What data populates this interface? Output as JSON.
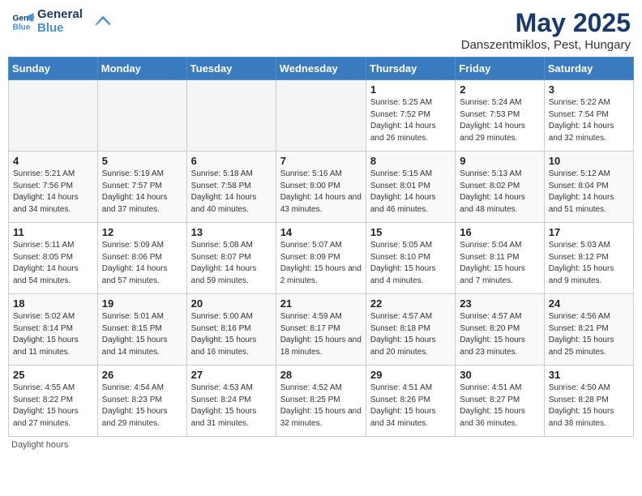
{
  "header": {
    "logo_line1": "General",
    "logo_line2": "Blue",
    "month_title": "May 2025",
    "location": "Danszentmiklos, Pest, Hungary"
  },
  "days_of_week": [
    "Sunday",
    "Monday",
    "Tuesday",
    "Wednesday",
    "Thursday",
    "Friday",
    "Saturday"
  ],
  "weeks": [
    [
      {
        "day": "",
        "empty": true
      },
      {
        "day": "",
        "empty": true
      },
      {
        "day": "",
        "empty": true
      },
      {
        "day": "",
        "empty": true
      },
      {
        "day": "1",
        "sunrise": "5:25 AM",
        "sunset": "7:52 PM",
        "daylight": "14 hours and 26 minutes."
      },
      {
        "day": "2",
        "sunrise": "5:24 AM",
        "sunset": "7:53 PM",
        "daylight": "14 hours and 29 minutes."
      },
      {
        "day": "3",
        "sunrise": "5:22 AM",
        "sunset": "7:54 PM",
        "daylight": "14 hours and 32 minutes."
      }
    ],
    [
      {
        "day": "4",
        "sunrise": "5:21 AM",
        "sunset": "7:56 PM",
        "daylight": "14 hours and 34 minutes."
      },
      {
        "day": "5",
        "sunrise": "5:19 AM",
        "sunset": "7:57 PM",
        "daylight": "14 hours and 37 minutes."
      },
      {
        "day": "6",
        "sunrise": "5:18 AM",
        "sunset": "7:58 PM",
        "daylight": "14 hours and 40 minutes."
      },
      {
        "day": "7",
        "sunrise": "5:16 AM",
        "sunset": "8:00 PM",
        "daylight": "14 hours and 43 minutes."
      },
      {
        "day": "8",
        "sunrise": "5:15 AM",
        "sunset": "8:01 PM",
        "daylight": "14 hours and 46 minutes."
      },
      {
        "day": "9",
        "sunrise": "5:13 AM",
        "sunset": "8:02 PM",
        "daylight": "14 hours and 48 minutes."
      },
      {
        "day": "10",
        "sunrise": "5:12 AM",
        "sunset": "8:04 PM",
        "daylight": "14 hours and 51 minutes."
      }
    ],
    [
      {
        "day": "11",
        "sunrise": "5:11 AM",
        "sunset": "8:05 PM",
        "daylight": "14 hours and 54 minutes."
      },
      {
        "day": "12",
        "sunrise": "5:09 AM",
        "sunset": "8:06 PM",
        "daylight": "14 hours and 57 minutes."
      },
      {
        "day": "13",
        "sunrise": "5:08 AM",
        "sunset": "8:07 PM",
        "daylight": "14 hours and 59 minutes."
      },
      {
        "day": "14",
        "sunrise": "5:07 AM",
        "sunset": "8:09 PM",
        "daylight": "15 hours and 2 minutes."
      },
      {
        "day": "15",
        "sunrise": "5:05 AM",
        "sunset": "8:10 PM",
        "daylight": "15 hours and 4 minutes."
      },
      {
        "day": "16",
        "sunrise": "5:04 AM",
        "sunset": "8:11 PM",
        "daylight": "15 hours and 7 minutes."
      },
      {
        "day": "17",
        "sunrise": "5:03 AM",
        "sunset": "8:12 PM",
        "daylight": "15 hours and 9 minutes."
      }
    ],
    [
      {
        "day": "18",
        "sunrise": "5:02 AM",
        "sunset": "8:14 PM",
        "daylight": "15 hours and 11 minutes."
      },
      {
        "day": "19",
        "sunrise": "5:01 AM",
        "sunset": "8:15 PM",
        "daylight": "15 hours and 14 minutes."
      },
      {
        "day": "20",
        "sunrise": "5:00 AM",
        "sunset": "8:16 PM",
        "daylight": "15 hours and 16 minutes."
      },
      {
        "day": "21",
        "sunrise": "4:59 AM",
        "sunset": "8:17 PM",
        "daylight": "15 hours and 18 minutes."
      },
      {
        "day": "22",
        "sunrise": "4:57 AM",
        "sunset": "8:18 PM",
        "daylight": "15 hours and 20 minutes."
      },
      {
        "day": "23",
        "sunrise": "4:57 AM",
        "sunset": "8:20 PM",
        "daylight": "15 hours and 23 minutes."
      },
      {
        "day": "24",
        "sunrise": "4:56 AM",
        "sunset": "8:21 PM",
        "daylight": "15 hours and 25 minutes."
      }
    ],
    [
      {
        "day": "25",
        "sunrise": "4:55 AM",
        "sunset": "8:22 PM",
        "daylight": "15 hours and 27 minutes."
      },
      {
        "day": "26",
        "sunrise": "4:54 AM",
        "sunset": "8:23 PM",
        "daylight": "15 hours and 29 minutes."
      },
      {
        "day": "27",
        "sunrise": "4:53 AM",
        "sunset": "8:24 PM",
        "daylight": "15 hours and 31 minutes."
      },
      {
        "day": "28",
        "sunrise": "4:52 AM",
        "sunset": "8:25 PM",
        "daylight": "15 hours and 32 minutes."
      },
      {
        "day": "29",
        "sunrise": "4:51 AM",
        "sunset": "8:26 PM",
        "daylight": "15 hours and 34 minutes."
      },
      {
        "day": "30",
        "sunrise": "4:51 AM",
        "sunset": "8:27 PM",
        "daylight": "15 hours and 36 minutes."
      },
      {
        "day": "31",
        "sunrise": "4:50 AM",
        "sunset": "8:28 PM",
        "daylight": "15 hours and 38 minutes."
      }
    ]
  ],
  "footer": {
    "note": "Daylight hours"
  }
}
